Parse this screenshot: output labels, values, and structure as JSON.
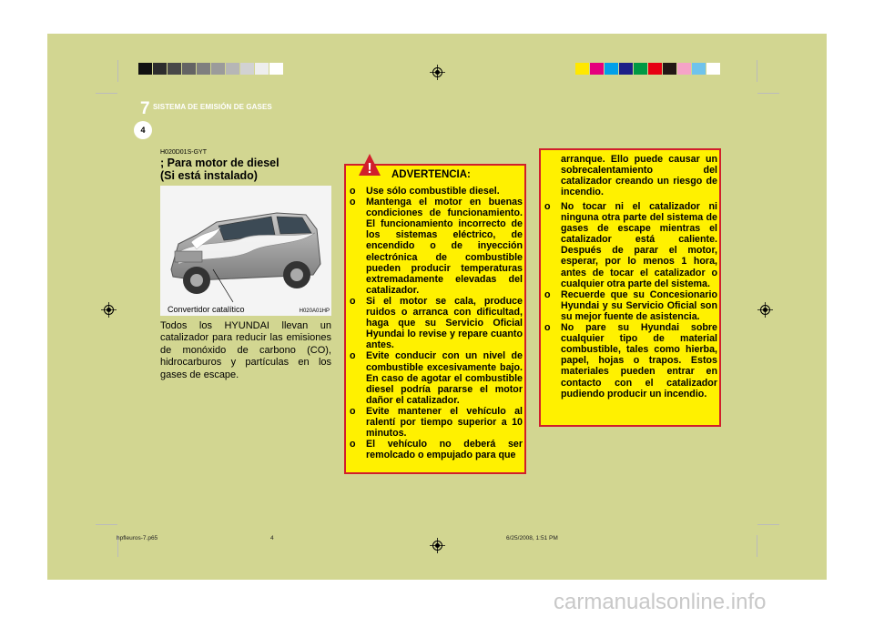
{
  "header": {
    "chapter_number": "7",
    "chapter_title": "SISTEMA DE EMISIÓN DE GASES",
    "page_number": "4"
  },
  "section": {
    "code": "H020D01S-GYT",
    "title_line1": "; Para motor de diesel",
    "title_line2": "(Si está instalado)"
  },
  "figure": {
    "label": "Convertidor catalítico",
    "code": "H020A01HP"
  },
  "body_text": "Todos los HYUNDAI llevan un catalizador para reducir las emisiones de monóxido de carbono (CO), hidrocarburos y partículas en los gases de escape.",
  "warning": {
    "icon": "exclamation-triangle-icon",
    "title": "ADVERTENCIA:",
    "bullet": "o",
    "items": [
      "Use sólo combustible diesel.",
      "Mantenga el motor en buenas condiciones de funcionamiento. El funcionamiento incorrecto de los sistemas eléctrico, de encendido o de inyección electrónica de combustible pueden producir temperaturas extremadamente elevadas del catalizador.",
      "Si el motor se cala, produce ruidos o arranca con dificultad, haga que su Servicio Oficial Hyundai lo revise y repare cuanto antes.",
      "Evite conducir con un nivel de combustible excesivamente bajo. En caso de agotar el combustible diesel podría pararse el motor dañor el catalizador.",
      "Evite mantener el vehículo al ralentí por tiempo superior a 10 minutos.",
      "El vehículo no deberá ser remolcado o empujado para que"
    ],
    "continuation": "arranque. Ello puede causar un sobrecalentamiento del catalizador creando un riesgo de incendio.",
    "items2": [
      "No tocar ni el catalizador ni ninguna otra parte del sistema de gases de escape mientras el catalizador está caliente. Después de parar el motor, esperar, por lo menos 1 hora, antes de tocar el catalizador o cualquier otra parte del sistema.",
      "Recuerde que su Concesionario Hyundai y su Servicio Oficial son su mejor fuente de asistencia.",
      "No pare su Hyundai sobre cualquier tipo de material combustible, tales como hierba, papel, hojas o trapos. Estos materiales pueden entrar en contacto con el catalizador pudiendo producir un incendio."
    ]
  },
  "footer": {
    "file": "hpfleuros-7.p65",
    "page": "4",
    "datetime": "6/25/2008, 1:51 PM"
  },
  "watermark": "carmanualsonline.info",
  "colors": {
    "page_bg": "#d2d691",
    "warning_bg": "#fff100",
    "warning_border": "#d11f2b",
    "gray_swatches": [
      "#111111",
      "#2d2d2d",
      "#484848",
      "#646464",
      "#7f7f7f",
      "#9b9b9b",
      "#b6b6b6",
      "#d2d2d2",
      "#eeeeee",
      "#ffffff"
    ],
    "color_swatches": [
      "#ffe800",
      "#e5007d",
      "#00a0e9",
      "#1d2088",
      "#009944",
      "#e60012",
      "#231815",
      "#f5a3c7",
      "#6fc3ec",
      "#ffffff"
    ]
  }
}
